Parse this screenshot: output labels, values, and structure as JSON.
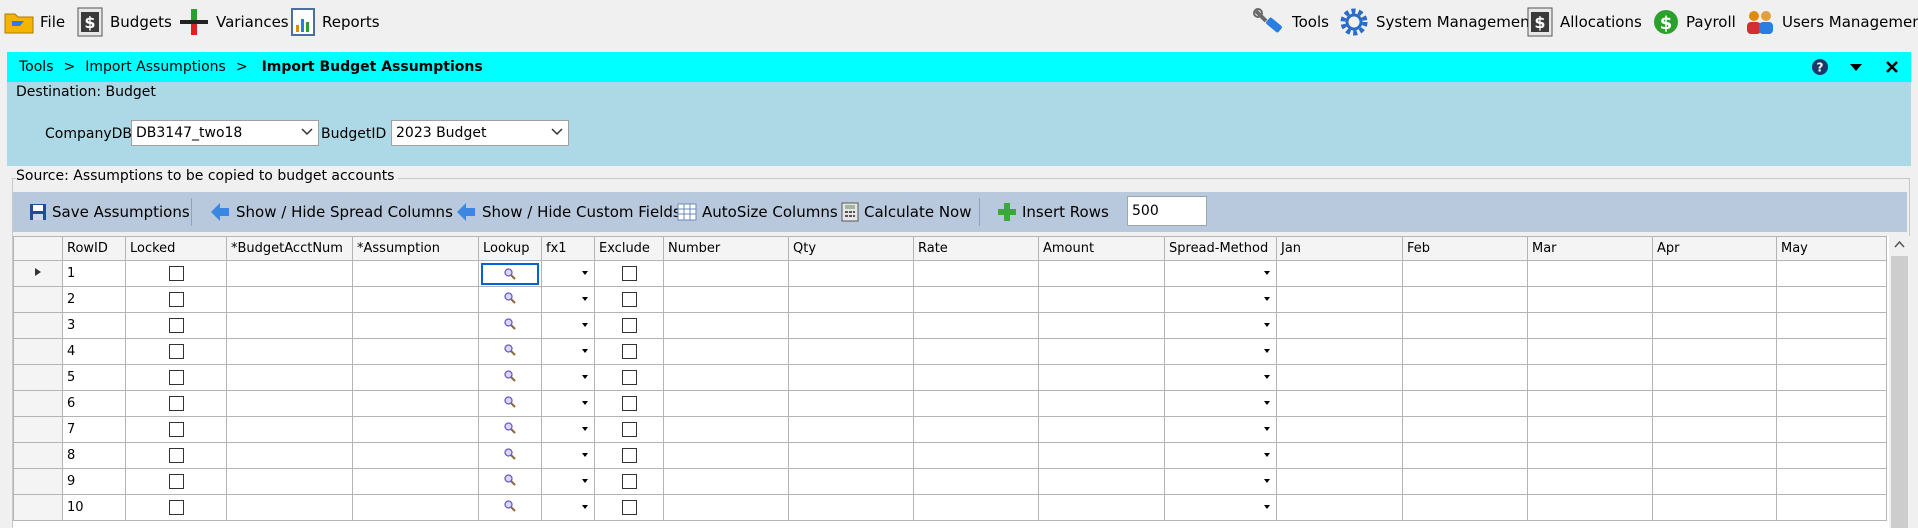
{
  "menu": {
    "left": [
      {
        "label": "File",
        "icon": "folder-icon"
      },
      {
        "label": "Budgets",
        "icon": "dollar-sheet-icon"
      },
      {
        "label": "Variances",
        "icon": "variance-icon"
      },
      {
        "label": "Reports",
        "icon": "report-icon"
      }
    ],
    "right": [
      {
        "label": "Tools",
        "icon": "wrench-icon"
      },
      {
        "label": "System Management",
        "icon": "gear-icon"
      },
      {
        "label": "Allocations",
        "icon": "dollar-sheet-icon"
      },
      {
        "label": "Payroll",
        "icon": "dollar-circle-icon"
      },
      {
        "label": "Users Management",
        "icon": "users-icon"
      }
    ]
  },
  "breadcrumb": {
    "items": [
      "Tools",
      "Import Assumptions",
      "Import Budget Assumptions"
    ],
    "separator": ">"
  },
  "destination": {
    "title": "Destination: Budget",
    "company_label": "CompanyDB",
    "company_value": "DB3147_two18",
    "budget_label": "BudgetID",
    "budget_value": "2023 Budget"
  },
  "source": {
    "title": "Source: Assumptions to be copied to budget accounts"
  },
  "toolbar": {
    "save": "Save Assumptions",
    "spread": "Show / Hide Spread Columns",
    "custom": "Show / Hide Custom Fields",
    "autosize": "AutoSize Columns",
    "calculate": "Calculate Now",
    "insert": "Insert Rows",
    "insert_count": "500"
  },
  "grid": {
    "columns": [
      "RowID",
      "Locked",
      "*BudgetAcctNum",
      "*Assumption",
      "Lookup",
      "fx1",
      "Exclude",
      "Number",
      "Qty",
      "Rate",
      "Amount",
      "Spread-Method",
      "Jan",
      "Feb",
      "Mar",
      "Apr",
      "May"
    ],
    "row_ids": [
      "1",
      "2",
      "3",
      "4",
      "5",
      "6",
      "7",
      "8",
      "9",
      "10"
    ]
  },
  "colors": {
    "breadcrumb_bg": "#00ffff",
    "destination_bg": "#add8e6",
    "toolbar_bg": "#b9c9dd",
    "selection": "#0063d8"
  }
}
